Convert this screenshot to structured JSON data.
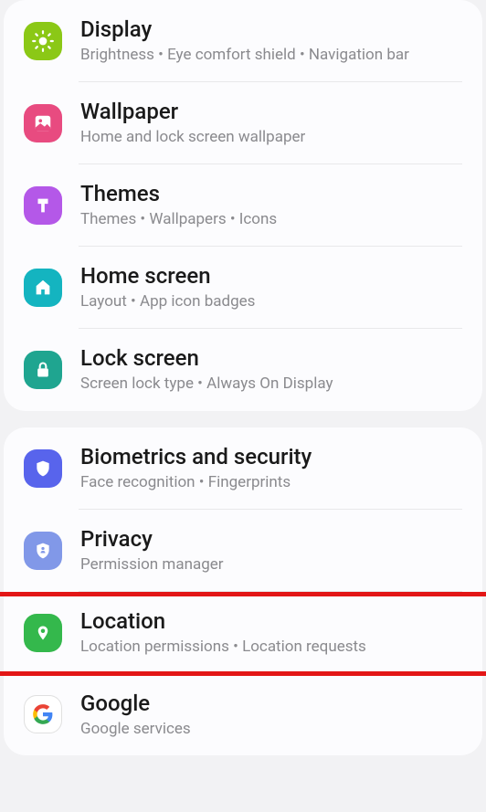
{
  "groups": [
    {
      "items": [
        {
          "id": "display",
          "title": "Display",
          "subtitle": "Brightness  •  Eye comfort shield  •  Navigation bar"
        },
        {
          "id": "wallpaper",
          "title": "Wallpaper",
          "subtitle": "Home and lock screen wallpaper"
        },
        {
          "id": "themes",
          "title": "Themes",
          "subtitle": "Themes  •  Wallpapers  •  Icons"
        },
        {
          "id": "homescreen",
          "title": "Home screen",
          "subtitle": "Layout  •  App icon badges"
        },
        {
          "id": "lockscreen",
          "title": "Lock screen",
          "subtitle": "Screen lock type  •  Always On Display"
        }
      ]
    },
    {
      "items": [
        {
          "id": "biometrics",
          "title": "Biometrics and security",
          "subtitle": "Face recognition  •  Fingerprints"
        },
        {
          "id": "privacy",
          "title": "Privacy",
          "subtitle": "Permission manager"
        },
        {
          "id": "location",
          "title": "Location",
          "subtitle": "Location permissions  •  Location requests",
          "highlighted": true
        },
        {
          "id": "google",
          "title": "Google",
          "subtitle": "Google services"
        }
      ]
    }
  ]
}
